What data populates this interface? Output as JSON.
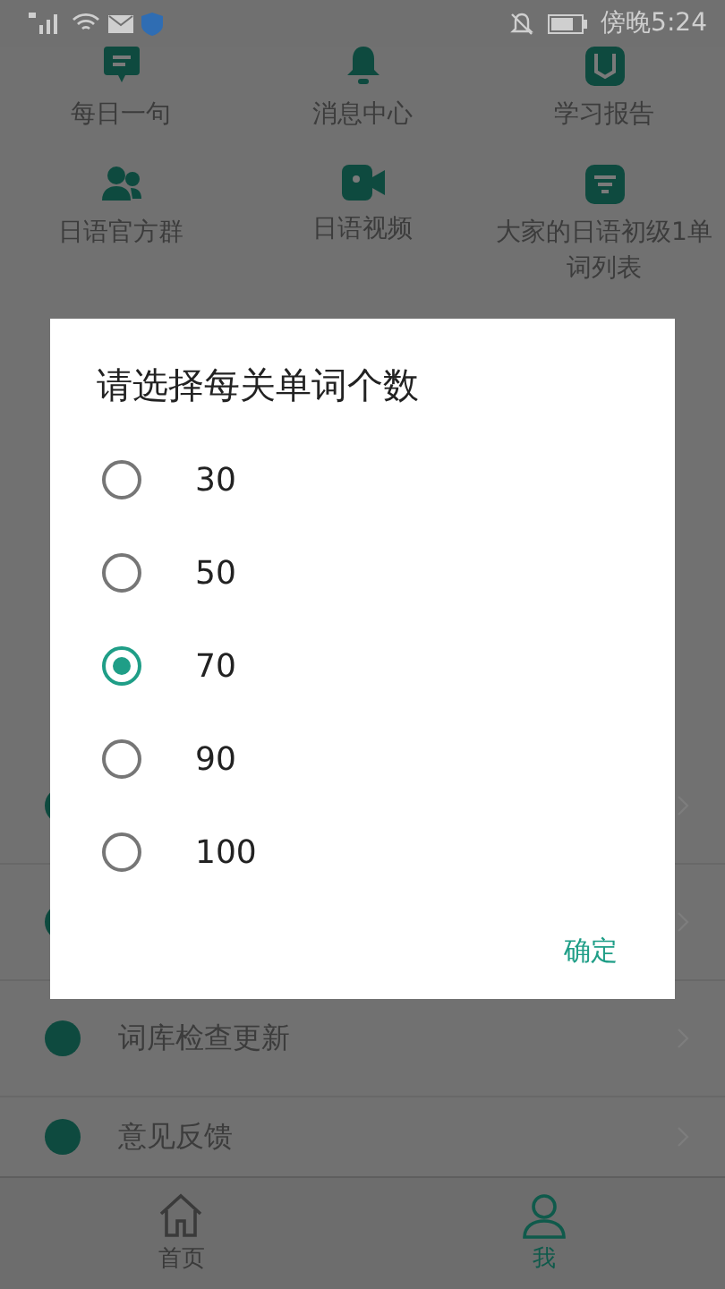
{
  "status_bar": {
    "time": "傍晚5:24"
  },
  "grid": [
    {
      "label": "每日一句"
    },
    {
      "label": "消息中心"
    },
    {
      "label": "学习报告"
    },
    {
      "label": "日语官方群"
    },
    {
      "label": "日语视频"
    },
    {
      "label": "大家的日语初级1单词列表"
    }
  ],
  "menu": [
    {
      "label": "词库检查更新"
    },
    {
      "label": "意见反馈"
    }
  ],
  "nav": [
    {
      "label": "首页",
      "selected": false
    },
    {
      "label": "我",
      "selected": true
    }
  ],
  "dialog": {
    "title": "请选择每关单词个数",
    "options": [
      {
        "label": "30",
        "selected": false
      },
      {
        "label": "50",
        "selected": false
      },
      {
        "label": "70",
        "selected": true
      },
      {
        "label": "90",
        "selected": false
      },
      {
        "label": "100",
        "selected": false
      }
    ],
    "confirm": "确定"
  }
}
